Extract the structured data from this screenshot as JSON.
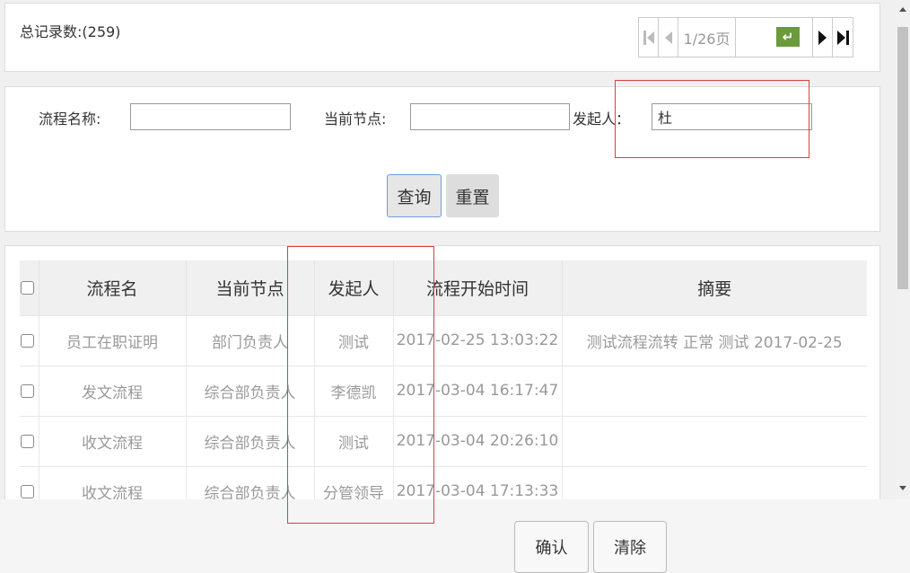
{
  "summary": {
    "total_label": "总记录数:(259)"
  },
  "pager": {
    "page_info": "1/26页",
    "go_icon": "enter-icon"
  },
  "search": {
    "process_name_label": "流程名称:",
    "process_name_value": "",
    "current_node_label": "当前节点:",
    "current_node_value": "",
    "initiator_label": "发起人：",
    "initiator_value": "杜",
    "query_label": "查询",
    "reset_label": "重置"
  },
  "table": {
    "headers": [
      "流程名",
      "当前节点",
      "发起人",
      "流程开始时间",
      "摘要"
    ],
    "rows": [
      {
        "name": "员工在职证明",
        "node": "部门负责人",
        "initiator": "测试",
        "start_time": "2017-02-25 13:03:22",
        "summary": "测试流程流转 正常 测试 2017-02-25"
      },
      {
        "name": "发文流程",
        "node": "综合部负责人",
        "initiator": "李德凯",
        "start_time": "2017-03-04 16:17:47",
        "summary": ""
      },
      {
        "name": "收文流程",
        "node": "综合部负责人",
        "initiator": "测试",
        "start_time": "2017-03-04 20:26:10",
        "summary": ""
      },
      {
        "name": "收文流程",
        "node": "综合部负责人",
        "initiator": "分管领导",
        "start_time": "2017-03-04 17:13:33",
        "summary": ""
      }
    ]
  },
  "footer": {
    "confirm_label": "确认",
    "clear_label": "清除"
  },
  "colors": {
    "highlight": "#d94040",
    "go_button": "#6a9a3a",
    "query_border": "#6a9ee0"
  }
}
